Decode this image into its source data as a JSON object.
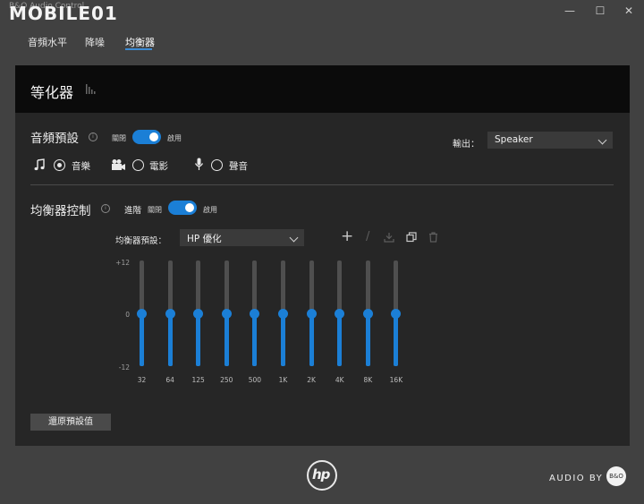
{
  "window": {
    "title": "B&O Audio Control",
    "watermark": "MOBILE01",
    "controls": {
      "minimize": "—",
      "maximize": "☐",
      "close": "✕"
    }
  },
  "nav": {
    "tabs": [
      {
        "label": "音頻水平",
        "active": false
      },
      {
        "label": "降噪",
        "active": false
      },
      {
        "label": "均衡器",
        "active": true
      }
    ]
  },
  "panel": {
    "title": "等化器",
    "audio_preset": {
      "title": "音頻預設",
      "toggle_off_label": "關閉",
      "toggle_on_label": "啟用",
      "enabled": true,
      "options": [
        {
          "label": "音樂",
          "icon": "music-note-icon",
          "selected": true
        },
        {
          "label": "電影",
          "icon": "movie-camera-icon",
          "selected": false
        },
        {
          "label": "聲音",
          "icon": "microphone-icon",
          "selected": false
        }
      ],
      "output_label": "輸出：",
      "output_value": "Speaker"
    },
    "eq_control": {
      "title": "均衡器控制",
      "advanced_label": "進階",
      "toggle_off_label": "關閉",
      "toggle_on_label": "啟用",
      "enabled": true,
      "preset_label": "均衡器預設：",
      "preset_value": "HP 優化",
      "db_labels": {
        "max": "+12",
        "mid": "0",
        "min": "-12"
      },
      "bands": [
        {
          "freq": "32",
          "gain_db": 0
        },
        {
          "freq": "64",
          "gain_db": 0
        },
        {
          "freq": "125",
          "gain_db": 0
        },
        {
          "freq": "250",
          "gain_db": 0
        },
        {
          "freq": "500",
          "gain_db": 0
        },
        {
          "freq": "1K",
          "gain_db": 0
        },
        {
          "freq": "2K",
          "gain_db": 0
        },
        {
          "freq": "4K",
          "gain_db": 0
        },
        {
          "freq": "8K",
          "gain_db": 0
        },
        {
          "freq": "16K",
          "gain_db": 0
        }
      ],
      "reset_label": "還原預設值"
    }
  },
  "footer": {
    "brand": "hp",
    "audio_by": "AUDIO BY",
    "bo_mark": "B&O"
  },
  "colors": {
    "accent": "#1b7fd6",
    "panel": "#262626",
    "background": "#414141"
  }
}
